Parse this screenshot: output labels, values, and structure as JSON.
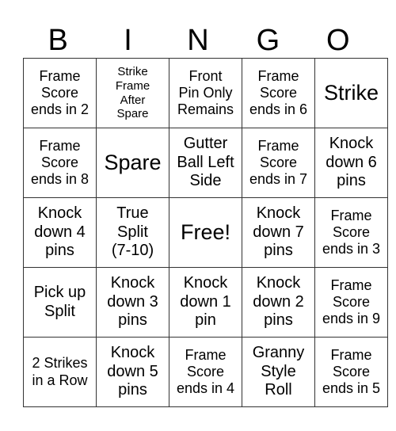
{
  "header": [
    "B",
    "I",
    "N",
    "G",
    "O"
  ],
  "cells": [
    [
      "Frame\nScore\nends in 2",
      "Strike\nFrame\nAfter\nSpare",
      "Front\nPin Only\nRemains",
      "Frame\nScore\nends in 6",
      "Strike"
    ],
    [
      "Frame\nScore\nends in 8",
      "Spare",
      "Gutter\nBall Left\nSide",
      "Frame\nScore\nends in 7",
      "Knock\ndown 6\npins"
    ],
    [
      "Knock\ndown 4\npins",
      "True\nSplit\n(7-10)",
      "Free!",
      "Knock\ndown 7\npins",
      "Frame\nScore\nends in 3"
    ],
    [
      "Pick up\nSplit",
      "Knock\ndown 3\npins",
      "Knock\ndown 1\npin",
      "Knock\ndown 2\npins",
      "Frame\nScore\nends in 9"
    ],
    [
      "2 Strikes\nin a Row",
      "Knock\ndown 5\npins",
      "Frame\nScore\nends in 4",
      "Granny\nStyle\nRoll",
      "Frame\nScore\nends in 5"
    ]
  ]
}
